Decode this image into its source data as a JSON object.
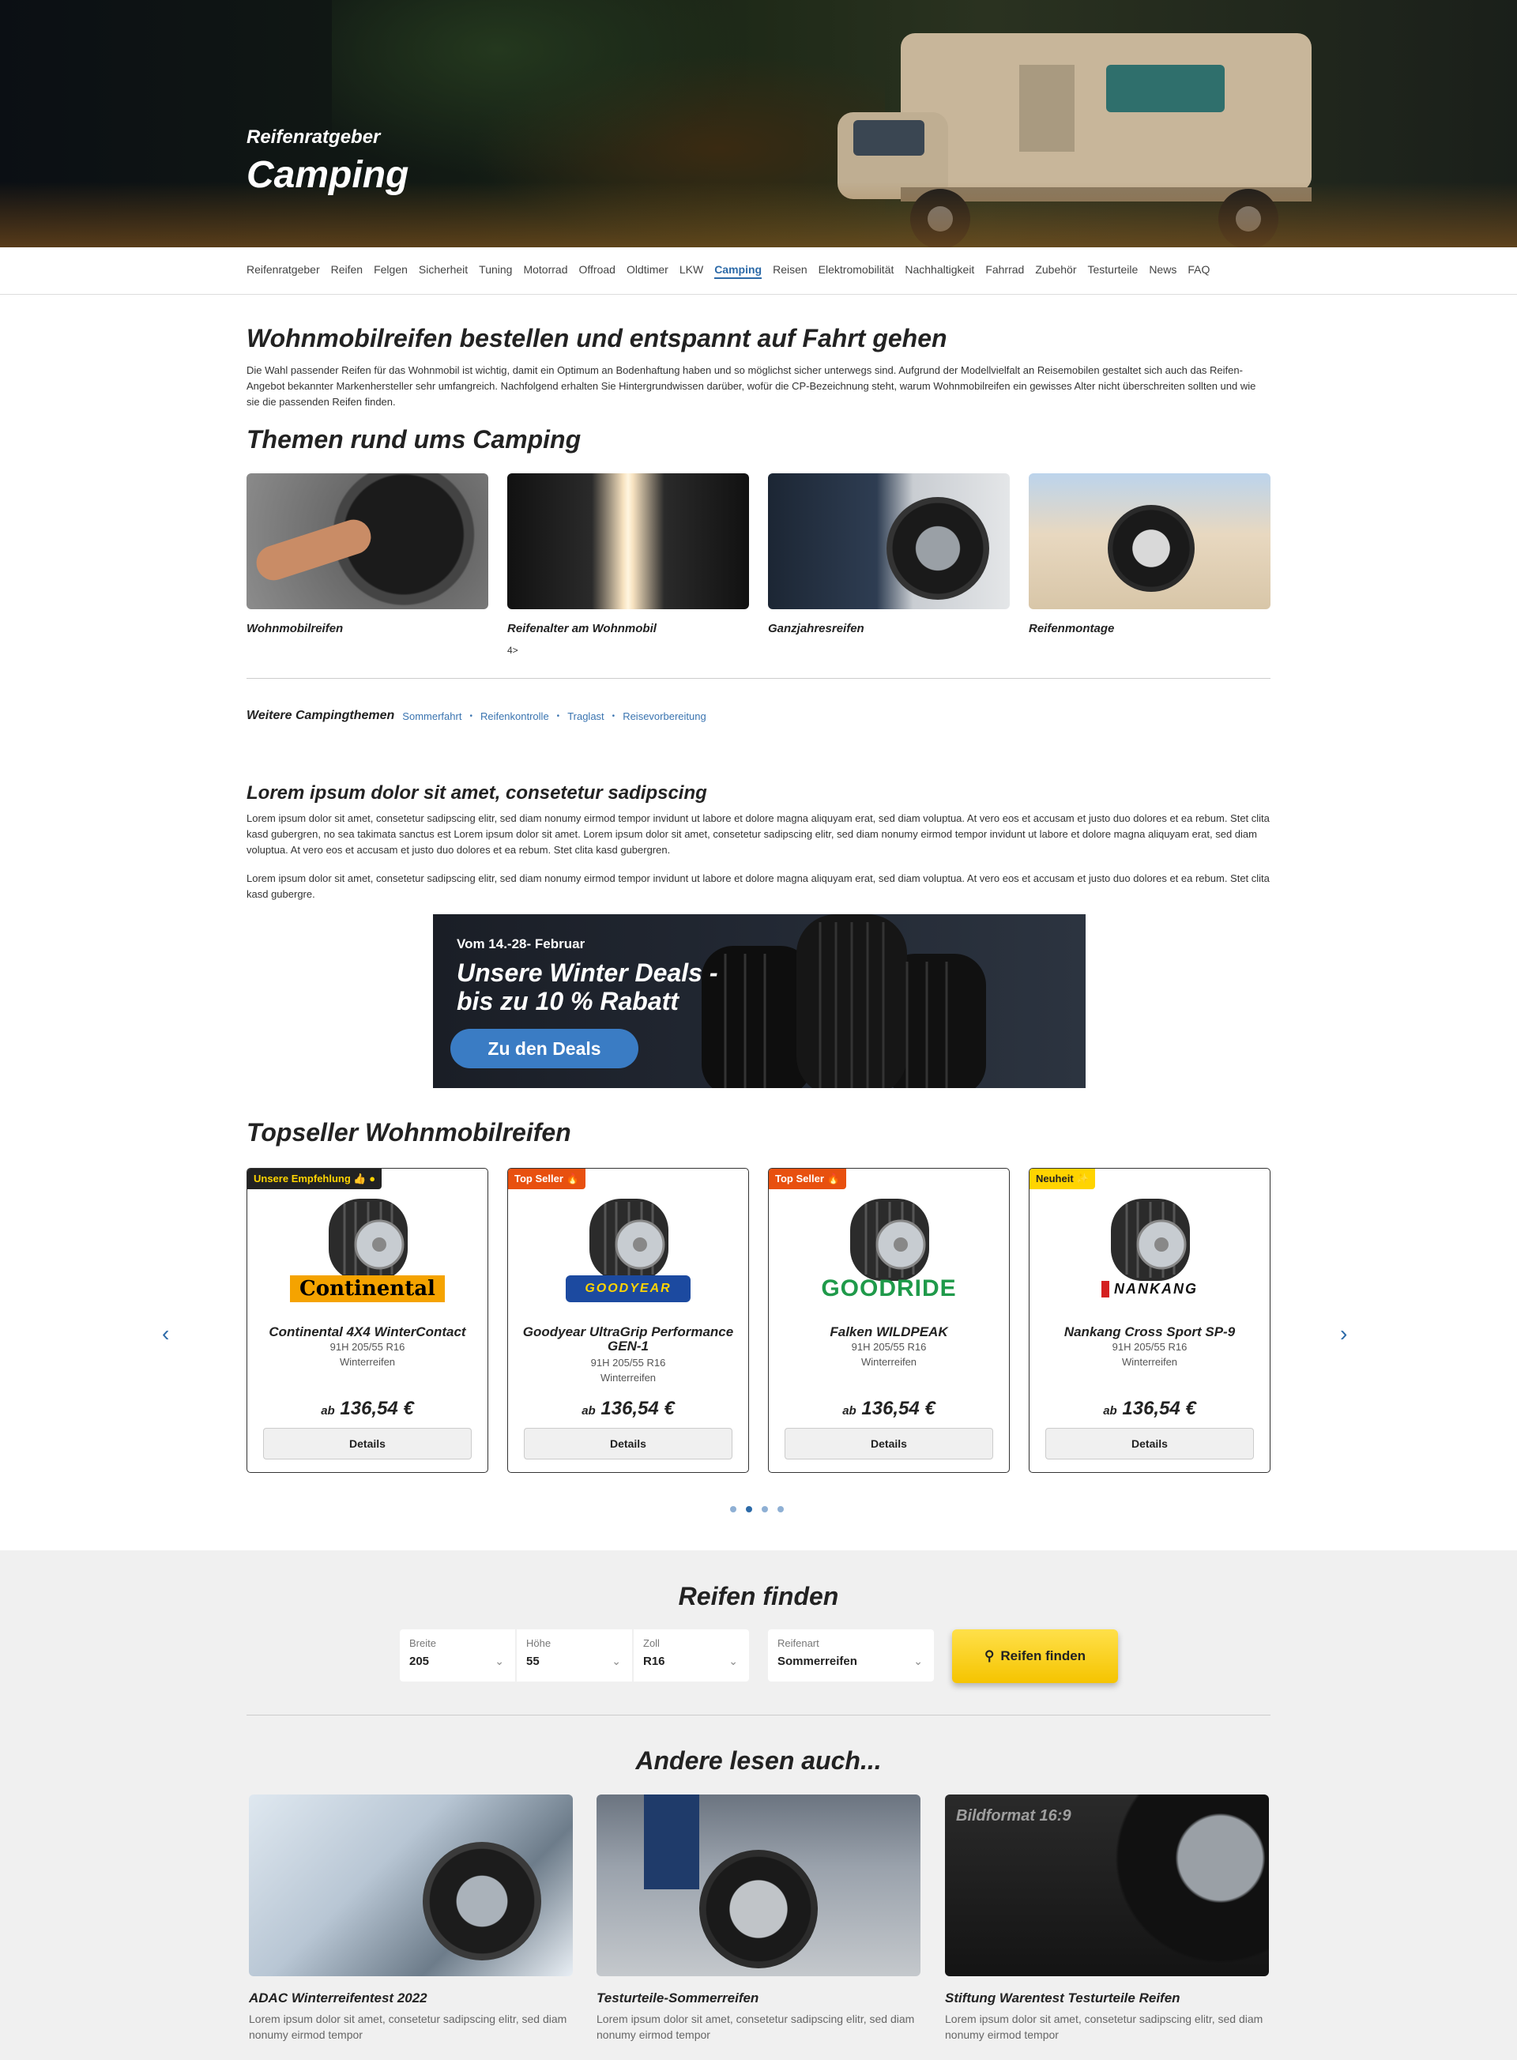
{
  "hero": {
    "subtitle": "Reifenratgeber",
    "title": "Camping"
  },
  "nav": [
    "Reifenratgeber",
    "Reifen",
    "Felgen",
    "Sicherheit",
    "Tuning",
    "Motorrad",
    "Offroad",
    "Oldtimer",
    "LKW",
    "Camping",
    "Reisen",
    "Elektromobilität",
    "Nachhaltigkeit",
    "Fahrrad",
    "Zubehör",
    "Testurteile",
    "News",
    "FAQ"
  ],
  "nav_active": "Camping",
  "intro": {
    "title": "Wohnmobilreifen bestellen und entspannt auf Fahrt gehen",
    "text": "Die Wahl passender Reifen für das Wohnmobil ist wichtig, damit ein Optimum an Bodenhaftung haben und so möglichst sicher unterwegs sind. Aufgrund der Modellvielfalt an Reisemobilen gestaltet sich auch das Reifen-Angebot bekannter Markenhersteller sehr umfangreich. Nachfolgend erhalten Sie Hintergrundwissen darüber, wofür die CP-Bezeichnung steht, warum Wohnmobilreifen ein gewisses Alter nicht überschreiten sollten und wie sie die passenden Reifen finden."
  },
  "themes": {
    "title": "Themen rund ums Camping",
    "items": [
      {
        "label": "Wohnmobilreifen",
        "icon": "tyre-hand-photo"
      },
      {
        "label": "Reifenalter am Wohnmobil",
        "extra": "4>",
        "icon": "tyre-stack-photo"
      },
      {
        "label": "Ganzjahresreifen",
        "icon": "mechanic-wheel-photo"
      },
      {
        "label": "Reifenmontage",
        "icon": "camper-wheel-photo"
      }
    ]
  },
  "more_topics": {
    "label": "Weitere Campingthemen",
    "tags": [
      "Sommerfahrt",
      "Reifenkontrolle",
      "Traglast",
      "Reisevorbereitung"
    ]
  },
  "lorem": {
    "title": "Lorem ipsum dolor sit amet, consetetur sadipscing",
    "p1": "Lorem ipsum dolor sit amet, consetetur sadipscing elitr, sed diam nonumy eirmod tempor invidunt ut labore et dolore magna aliquyam erat, sed diam voluptua. At vero eos et accusam et justo duo dolores et ea rebum. Stet clita kasd gubergren, no sea takimata sanctus est Lorem ipsum dolor sit amet. Lorem ipsum dolor sit amet, consetetur sadipscing elitr, sed diam nonumy eirmod tempor invidunt ut labore et dolore magna aliquyam erat, sed diam voluptua. At vero eos et accusam et justo duo dolores et ea rebum. Stet clita kasd gubergren.",
    "p2": "Lorem ipsum dolor sit amet, consetetur sadipscing elitr, sed diam nonumy eirmod tempor invidunt ut labore et dolore magna aliquyam erat, sed diam voluptua. At vero eos et accusam et justo duo dolores et ea rebum. Stet clita kasd gubergre."
  },
  "banner": {
    "date": "Vom 14.-28- Februar",
    "line1": "Unsere Winter Deals -",
    "line2": "bis zu 10 % Rabatt",
    "button": "Zu den Deals"
  },
  "topseller": {
    "title": "Topseller Wohnmobilreifen",
    "products": [
      {
        "badge": "Unsere Empfehlung 👍 ●",
        "badge_bg": "#222222",
        "badge_fg": "#ffd400",
        "brand": "Continental",
        "name": "Continental 4X4 WinterContact",
        "spec": "91H 205/55 R16",
        "season": "Winterreifen",
        "price_prefix": "ab",
        "price": "136,54 €",
        "button": "Details"
      },
      {
        "badge": "Top Seller 🔥",
        "badge_bg": "#e8500f",
        "badge_fg": "#ffffff",
        "brand": "GOODYEAR",
        "name": "Goodyear UltraGrip Performance GEN-1",
        "spec": "91H 205/55 R16",
        "season": "Winterreifen",
        "price_prefix": "ab",
        "price": "136,54 €",
        "button": "Details"
      },
      {
        "badge": "Top Seller 🔥",
        "badge_bg": "#e8500f",
        "badge_fg": "#ffffff",
        "brand": "GOODRIDE",
        "name": "Falken WILDPEAK",
        "spec": "91H 205/55 R16",
        "season": "Winterreifen",
        "price_prefix": "ab",
        "price": "136,54 €",
        "button": "Details"
      },
      {
        "badge": "Neuheit ✨",
        "badge_bg": "#ffd400",
        "badge_fg": "#222222",
        "brand": "NANKANG",
        "name": "Nankang Cross Sport SP-9",
        "spec": "91H 205/55 R16",
        "season": "Winterreifen",
        "price_prefix": "ab",
        "price": "136,54 €",
        "button": "Details"
      }
    ],
    "carousel_page": 2,
    "carousel_total": 4
  },
  "finder": {
    "title": "Reifen finden",
    "fields": [
      {
        "label": "Breite",
        "value": "205"
      },
      {
        "label": "Höhe",
        "value": "55"
      },
      {
        "label": "Zoll",
        "value": "R16"
      },
      {
        "label": "Reifenart",
        "value": "Sommerreifen"
      }
    ],
    "button": "Reifen finden",
    "button_icon": "search-icon"
  },
  "read_more": {
    "title": "Andere lesen auch...",
    "articles": [
      {
        "title": "ADAC Winterreifentest 2022",
        "text": "Lorem ipsum dolor sit amet, consetetur sadipscing elitr, sed diam nonumy eirmod tempor"
      },
      {
        "title": "Testurteile-Sommerreifen",
        "text": "Lorem ipsum dolor sit amet, consetetur sadipscing elitr, sed diam nonumy eirmod tempor"
      },
      {
        "title": "Stiftung Warentest Testurteile Reifen",
        "text": "Lorem ipsum dolor sit amet, consetetur sadipscing elitr, sed diam nonumy eirmod tempor",
        "overlay": "Bildformat 16:9"
      }
    ]
  },
  "colors": {
    "accent": "#2c6aa8",
    "finder_button": "#f5c400",
    "banner_button": "#3a7cc4"
  }
}
